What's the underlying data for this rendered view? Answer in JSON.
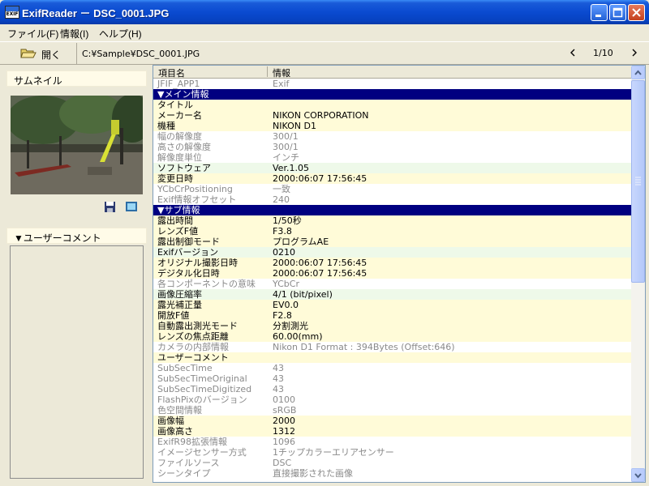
{
  "window": {
    "title": "ExifReader － DSC_0001.JPG",
    "icon_text": "EXIF"
  },
  "menu": [
    {
      "label": "ファイル(F)"
    },
    {
      "label": "情報(I)"
    },
    {
      "label": "ヘルプ(H)"
    }
  ],
  "toolbar": {
    "open_label": "開く",
    "path": "C:¥Sample¥DSC_0001.JPG",
    "page_indicator": "1/10"
  },
  "left": {
    "thumbnail_header": "サムネイル",
    "comment_header": "▼ユーザーコメント"
  },
  "table": {
    "headers": [
      "項目名",
      "情報"
    ],
    "rows": [
      {
        "k": "JFIF_APP1",
        "v": "Exif",
        "t": "w"
      },
      {
        "k": "▼メイン情報",
        "v": "",
        "t": "section"
      },
      {
        "k": "タイトル",
        "v": "",
        "t": "y"
      },
      {
        "k": "メーカー名",
        "v": "NIKON CORPORATION",
        "t": "y"
      },
      {
        "k": "機種",
        "v": "NIKON D1",
        "t": "y"
      },
      {
        "k": "幅の解像度",
        "v": "300/1",
        "t": "w"
      },
      {
        "k": "高さの解像度",
        "v": "300/1",
        "t": "w"
      },
      {
        "k": "解像度単位",
        "v": "インチ",
        "t": "w"
      },
      {
        "k": "ソフトウェア",
        "v": "Ver.1.05",
        "t": "g"
      },
      {
        "k": "変更日時",
        "v": "2000:06:07 17:56:45",
        "t": "y"
      },
      {
        "k": "YCbCrPositioning",
        "v": "一致",
        "t": "w"
      },
      {
        "k": "Exif情報オフセット",
        "v": "240",
        "t": "w"
      },
      {
        "k": "▼サブ情報",
        "v": "",
        "t": "section"
      },
      {
        "k": "露出時間",
        "v": "1/50秒",
        "t": "y"
      },
      {
        "k": "レンズF値",
        "v": "F3.8",
        "t": "y"
      },
      {
        "k": "露出制御モード",
        "v": "プログラムAE",
        "t": "y"
      },
      {
        "k": "Exifバージョン",
        "v": "0210",
        "t": "g"
      },
      {
        "k": "オリジナル撮影日時",
        "v": "2000:06:07 17:56:45",
        "t": "y"
      },
      {
        "k": "デジタル化日時",
        "v": "2000:06:07 17:56:45",
        "t": "y"
      },
      {
        "k": "各コンポーネントの意味",
        "v": "YCbCr",
        "t": "w"
      },
      {
        "k": "画像圧縮率",
        "v": "4/1 (bit/pixel)",
        "t": "g"
      },
      {
        "k": "露光補正量",
        "v": "EV0.0",
        "t": "y"
      },
      {
        "k": "開放F値",
        "v": "F2.8",
        "t": "y"
      },
      {
        "k": "自動露出測光モード",
        "v": "分割測光",
        "t": "y"
      },
      {
        "k": "レンズの焦点距離",
        "v": "60.00(mm)",
        "t": "y"
      },
      {
        "k": "カメラの内部情報",
        "v": "Nikon D1 Format : 394Bytes (Offset:646)",
        "t": "w"
      },
      {
        "k": "ユーザーコメント",
        "v": "",
        "t": "y"
      },
      {
        "k": "SubSecTime",
        "v": "43",
        "t": "w"
      },
      {
        "k": "SubSecTimeOriginal",
        "v": "43",
        "t": "w"
      },
      {
        "k": "SubSecTimeDigitized",
        "v": "43",
        "t": "w"
      },
      {
        "k": "FlashPixのバージョン",
        "v": "0100",
        "t": "w"
      },
      {
        "k": "色空間情報",
        "v": "sRGB",
        "t": "w"
      },
      {
        "k": "画像幅",
        "v": "2000",
        "t": "y"
      },
      {
        "k": "画像高さ",
        "v": "1312",
        "t": "y"
      },
      {
        "k": "ExifR98拡張情報",
        "v": "1096",
        "t": "w"
      },
      {
        "k": "イメージセンサー方式",
        "v": "1チップカラーエリアセンサー",
        "t": "w"
      },
      {
        "k": "ファイルソース",
        "v": "DSC",
        "t": "w"
      },
      {
        "k": "シーンタイプ",
        "v": "直接撮影された画像",
        "t": "w"
      }
    ]
  },
  "colors": {
    "title_bar": "#0a4ad0",
    "section_bg": "#000080",
    "highlight_row": "#fffbd8",
    "green_row": "#eef9e9"
  }
}
